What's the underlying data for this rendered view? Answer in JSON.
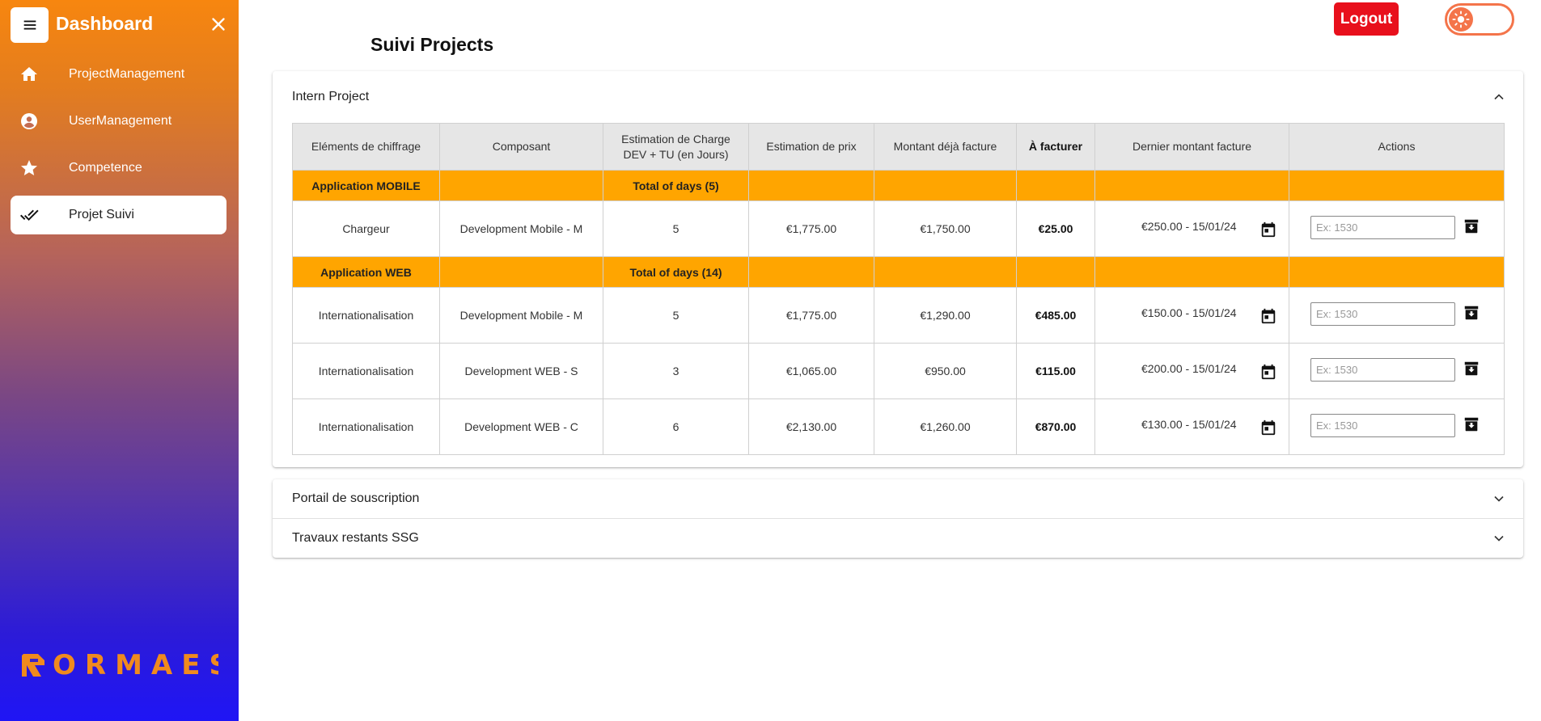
{
  "sidebar": {
    "title": "Dashboard",
    "items": [
      {
        "label": "ProjectManagement",
        "icon": "home-icon"
      },
      {
        "label": "UserManagement",
        "icon": "account-circle-icon"
      },
      {
        "label": "Competence",
        "icon": "star-icon"
      },
      {
        "label": "Projet Suivi",
        "icon": "done-all-icon",
        "active": true
      }
    ],
    "logo_text": "ORMAES"
  },
  "header": {
    "logout_label": "Logout",
    "theme_toggle": "light"
  },
  "page_title": "Suivi Projects",
  "panels": [
    {
      "title": "Intern Project",
      "expanded": true
    },
    {
      "title": "Portail de souscription",
      "expanded": false
    },
    {
      "title": "Travaux restants SSG",
      "expanded": false
    }
  ],
  "table": {
    "headers": [
      "Eléments de chiffrage",
      "Composant",
      "Estimation de Charge DEV + TU (en Jours)",
      "Estimation de prix",
      "Montant déjà facture",
      "À facturer",
      "Dernier montant facture",
      "Actions"
    ],
    "groups": [
      {
        "name": "Application MOBILE",
        "total": "Total of days (5)",
        "rows": [
          {
            "element": "Chargeur",
            "composant": "Development Mobile - M",
            "charge": "5",
            "prix": "€1,775.00",
            "deja": "€1,750.00",
            "afacturer": "€25.00",
            "dernier": "€250.00 - 15/01/24",
            "placeholder": "Ex: 1530"
          }
        ]
      },
      {
        "name": "Application WEB",
        "total": "Total of days (14)",
        "rows": [
          {
            "element": "Internationalisation",
            "composant": "Development Mobile - M",
            "charge": "5",
            "prix": "€1,775.00",
            "deja": "€1,290.00",
            "afacturer": "€485.00",
            "dernier": "€150.00 - 15/01/24",
            "placeholder": "Ex: 1530"
          },
          {
            "element": "Internationalisation",
            "composant": "Development WEB - S",
            "charge": "3",
            "prix": "€1,065.00",
            "deja": "€950.00",
            "afacturer": "€115.00",
            "dernier": "€200.00 - 15/01/24",
            "placeholder": "Ex: 1530"
          },
          {
            "element": "Internationalisation",
            "composant": "Development WEB - C",
            "charge": "6",
            "prix": "€2,130.00",
            "deja": "€1,260.00",
            "afacturer": "€870.00",
            "dernier": "€130.00 - 15/01/24",
            "placeholder": "Ex: 1530"
          }
        ]
      }
    ]
  },
  "colors": {
    "group_row": "#ffa500",
    "logout": "#e8101c",
    "toggle": "#f4744a",
    "sidebar_top": "#f7860f",
    "sidebar_bottom": "#1f15f5"
  }
}
